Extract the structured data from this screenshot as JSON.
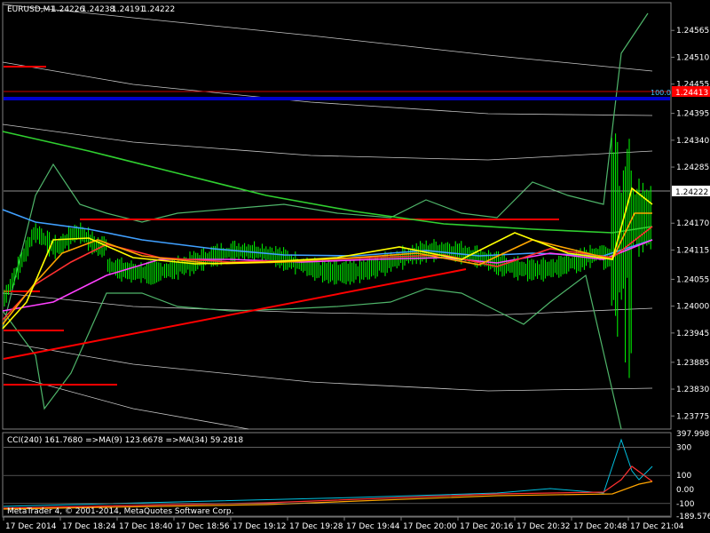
{
  "chart_data": {
    "type": "line",
    "title": "EURUSD,M1",
    "ohlc": {
      "open": "1.24226",
      "high": "1.24238",
      "low": "1.24191",
      "close": "1.24222"
    },
    "price_axis": {
      "min": 1.2375,
      "max": 1.2462,
      "ticks": [
        "1.24565",
        "1.24510",
        "1.24455",
        "1.24395",
        "1.24340",
        "1.24285",
        "1.24170",
        "1.24115",
        "1.24055",
        "1.24000",
        "1.23945",
        "1.23885",
        "1.23830",
        "1.23775"
      ],
      "current_price": "1.24222",
      "red_marker": "1.24413",
      "fib_label": "100.0"
    },
    "time_axis": {
      "labels": [
        "17 Dec 2014",
        "17 Dec 18:24",
        "17 Dec 18:40",
        "17 Dec 18:56",
        "17 Dec 19:12",
        "17 Dec 19:28",
        "17 Dec 19:44",
        "17 Dec 20:00",
        "17 Dec 20:16",
        "17 Dec 20:32",
        "17 Dec 20:48",
        "17 Dec 21:04"
      ]
    },
    "series": [
      {
        "name": "MA yellow",
        "color": "#ffff00"
      },
      {
        "name": "MA orange",
        "color": "#ffa500"
      },
      {
        "name": "MA red",
        "color": "#ff3030"
      },
      {
        "name": "MA magenta",
        "color": "#ff40ff"
      },
      {
        "name": "MA blue",
        "color": "#40a0ff"
      },
      {
        "name": "MA green",
        "color": "#30d030"
      }
    ],
    "grid": false,
    "indicator": {
      "text": "CCI(240) 161.7680  =>MA(9) 123.6678  =>MA(34) 59.2818",
      "ticks": [
        "397.9989",
        "300",
        "100",
        "0.00",
        "-100",
        "-189.5764"
      ],
      "min": -189.5764,
      "max": 397.9989
    },
    "copyright": "MetaTrader 4, © 2001-2014, MetaQuotes Software Corp."
  },
  "colors": {
    "background": "#000000",
    "candles": "#00ff00",
    "bollinger": "#4fb56a",
    "envelope": "#c8c8c8",
    "trendline": "#ff0000",
    "blue_level": "#0000cc",
    "current_line": "#c0c0c0"
  }
}
